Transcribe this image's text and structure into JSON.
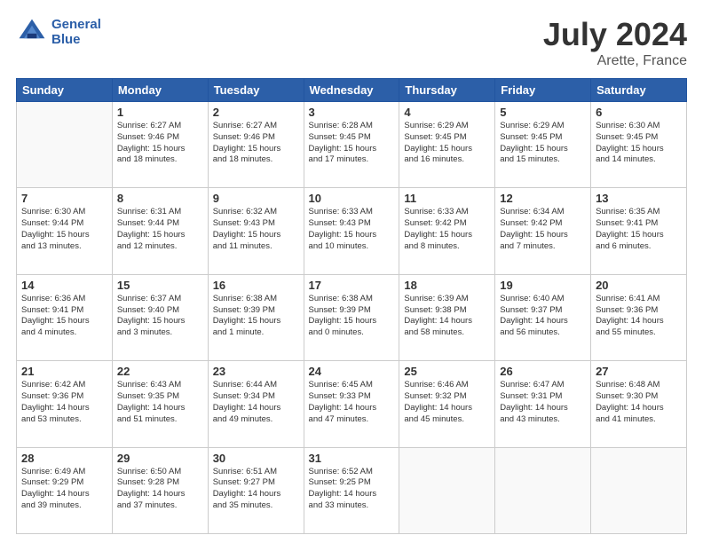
{
  "header": {
    "logo_line1": "General",
    "logo_line2": "Blue",
    "title": "July 2024",
    "subtitle": "Arette, France"
  },
  "weekdays": [
    "Sunday",
    "Monday",
    "Tuesday",
    "Wednesday",
    "Thursday",
    "Friday",
    "Saturday"
  ],
  "weeks": [
    [
      {
        "day": "",
        "info": ""
      },
      {
        "day": "1",
        "info": "Sunrise: 6:27 AM\nSunset: 9:46 PM\nDaylight: 15 hours\nand 18 minutes."
      },
      {
        "day": "2",
        "info": "Sunrise: 6:27 AM\nSunset: 9:46 PM\nDaylight: 15 hours\nand 18 minutes."
      },
      {
        "day": "3",
        "info": "Sunrise: 6:28 AM\nSunset: 9:45 PM\nDaylight: 15 hours\nand 17 minutes."
      },
      {
        "day": "4",
        "info": "Sunrise: 6:29 AM\nSunset: 9:45 PM\nDaylight: 15 hours\nand 16 minutes."
      },
      {
        "day": "5",
        "info": "Sunrise: 6:29 AM\nSunset: 9:45 PM\nDaylight: 15 hours\nand 15 minutes."
      },
      {
        "day": "6",
        "info": "Sunrise: 6:30 AM\nSunset: 9:45 PM\nDaylight: 15 hours\nand 14 minutes."
      }
    ],
    [
      {
        "day": "7",
        "info": "Sunrise: 6:30 AM\nSunset: 9:44 PM\nDaylight: 15 hours\nand 13 minutes."
      },
      {
        "day": "8",
        "info": "Sunrise: 6:31 AM\nSunset: 9:44 PM\nDaylight: 15 hours\nand 12 minutes."
      },
      {
        "day": "9",
        "info": "Sunrise: 6:32 AM\nSunset: 9:43 PM\nDaylight: 15 hours\nand 11 minutes."
      },
      {
        "day": "10",
        "info": "Sunrise: 6:33 AM\nSunset: 9:43 PM\nDaylight: 15 hours\nand 10 minutes."
      },
      {
        "day": "11",
        "info": "Sunrise: 6:33 AM\nSunset: 9:42 PM\nDaylight: 15 hours\nand 8 minutes."
      },
      {
        "day": "12",
        "info": "Sunrise: 6:34 AM\nSunset: 9:42 PM\nDaylight: 15 hours\nand 7 minutes."
      },
      {
        "day": "13",
        "info": "Sunrise: 6:35 AM\nSunset: 9:41 PM\nDaylight: 15 hours\nand 6 minutes."
      }
    ],
    [
      {
        "day": "14",
        "info": "Sunrise: 6:36 AM\nSunset: 9:41 PM\nDaylight: 15 hours\nand 4 minutes."
      },
      {
        "day": "15",
        "info": "Sunrise: 6:37 AM\nSunset: 9:40 PM\nDaylight: 15 hours\nand 3 minutes."
      },
      {
        "day": "16",
        "info": "Sunrise: 6:38 AM\nSunset: 9:39 PM\nDaylight: 15 hours\nand 1 minute."
      },
      {
        "day": "17",
        "info": "Sunrise: 6:38 AM\nSunset: 9:39 PM\nDaylight: 15 hours\nand 0 minutes."
      },
      {
        "day": "18",
        "info": "Sunrise: 6:39 AM\nSunset: 9:38 PM\nDaylight: 14 hours\nand 58 minutes."
      },
      {
        "day": "19",
        "info": "Sunrise: 6:40 AM\nSunset: 9:37 PM\nDaylight: 14 hours\nand 56 minutes."
      },
      {
        "day": "20",
        "info": "Sunrise: 6:41 AM\nSunset: 9:36 PM\nDaylight: 14 hours\nand 55 minutes."
      }
    ],
    [
      {
        "day": "21",
        "info": "Sunrise: 6:42 AM\nSunset: 9:36 PM\nDaylight: 14 hours\nand 53 minutes."
      },
      {
        "day": "22",
        "info": "Sunrise: 6:43 AM\nSunset: 9:35 PM\nDaylight: 14 hours\nand 51 minutes."
      },
      {
        "day": "23",
        "info": "Sunrise: 6:44 AM\nSunset: 9:34 PM\nDaylight: 14 hours\nand 49 minutes."
      },
      {
        "day": "24",
        "info": "Sunrise: 6:45 AM\nSunset: 9:33 PM\nDaylight: 14 hours\nand 47 minutes."
      },
      {
        "day": "25",
        "info": "Sunrise: 6:46 AM\nSunset: 9:32 PM\nDaylight: 14 hours\nand 45 minutes."
      },
      {
        "day": "26",
        "info": "Sunrise: 6:47 AM\nSunset: 9:31 PM\nDaylight: 14 hours\nand 43 minutes."
      },
      {
        "day": "27",
        "info": "Sunrise: 6:48 AM\nSunset: 9:30 PM\nDaylight: 14 hours\nand 41 minutes."
      }
    ],
    [
      {
        "day": "28",
        "info": "Sunrise: 6:49 AM\nSunset: 9:29 PM\nDaylight: 14 hours\nand 39 minutes."
      },
      {
        "day": "29",
        "info": "Sunrise: 6:50 AM\nSunset: 9:28 PM\nDaylight: 14 hours\nand 37 minutes."
      },
      {
        "day": "30",
        "info": "Sunrise: 6:51 AM\nSunset: 9:27 PM\nDaylight: 14 hours\nand 35 minutes."
      },
      {
        "day": "31",
        "info": "Sunrise: 6:52 AM\nSunset: 9:25 PM\nDaylight: 14 hours\nand 33 minutes."
      },
      {
        "day": "",
        "info": ""
      },
      {
        "day": "",
        "info": ""
      },
      {
        "day": "",
        "info": ""
      }
    ]
  ]
}
